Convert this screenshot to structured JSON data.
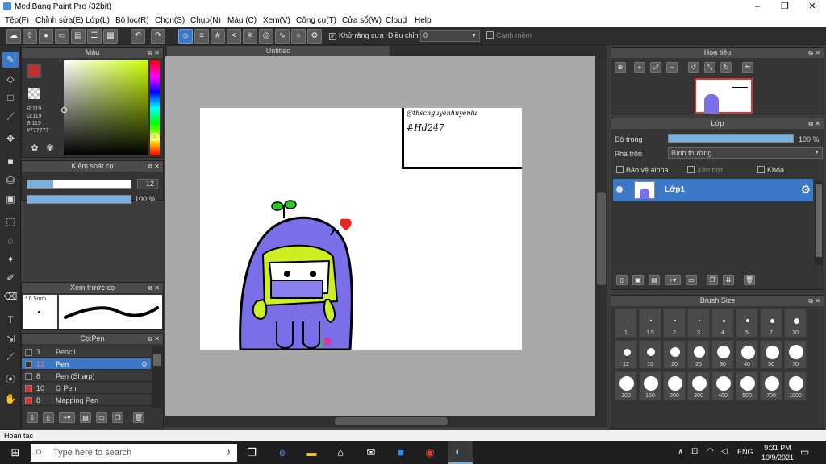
{
  "window": {
    "title": "MediBang Paint Pro (32bit)",
    "min": "–",
    "max": "❐",
    "close": "✕"
  },
  "menu": [
    "Tệp(F)",
    "Chỉnh sửa(E)",
    "Lớp(L)",
    "Bộ lọc(R)",
    "Chọn(S)",
    "Chụp(N)",
    "Màu (C)",
    "Xem(V)",
    "Công cụ(T)",
    "Cửa sổ(W)",
    "Cloud",
    "Help"
  ],
  "toolbar": {
    "antialias": "Khử răng cưa",
    "adjust_label": "Điều chỉnh",
    "adjust_value": "0",
    "edge": "Cạnh mềm"
  },
  "color_panel": {
    "title": "Màu",
    "r": "R:119",
    "g": "G:119",
    "b": "B:119",
    "hex": "#777777",
    "colors": {
      "primary": "#c03030",
      "accent": "#3c78c8"
    }
  },
  "brush_control": {
    "title": "Kiểm soát cọ",
    "size": "12",
    "opacity": "100 %",
    "size_fraction": 0.25,
    "opacity_fraction": 1.0
  },
  "brush_preview": {
    "title": "Xem trước cọ",
    "size": "0.5mm"
  },
  "brush_list": {
    "title": "Cọ:Pen",
    "items": [
      {
        "size": "3",
        "name": "Pencil",
        "color": "#333333"
      },
      {
        "size": "12",
        "name": "Pen",
        "color": "#333333",
        "selected": true
      },
      {
        "size": "8",
        "name": "Pen (Sharp)",
        "color": "#333333"
      },
      {
        "size": "10",
        "name": "G Pen",
        "color": "#e03030"
      },
      {
        "size": "8",
        "name": "Mapping Pen",
        "color": "#e03030"
      }
    ]
  },
  "canvas": {
    "tab": "Untitled",
    "sig_line1": "@thscnguyenhuyenlu",
    "sig_line2": "#Hd247"
  },
  "navigator": {
    "title": "Hoa tiêu"
  },
  "layer_panel": {
    "title": "Lớp",
    "opacity_label": "Độ trong",
    "opacity_value": "100 %",
    "blend_label": "Pha trộn",
    "blend_value": "Bình thường",
    "protect_alpha": "Bảo vệ alpha",
    "clip": "Xén bớt",
    "lock": "Khóa",
    "layer_name": "Lớp1"
  },
  "brush_size": {
    "title": "Brush Size",
    "sizes": [
      "1",
      "1.5",
      "2",
      "3",
      "4",
      "5",
      "7",
      "10",
      "12",
      "15",
      "20",
      "25",
      "30",
      "40",
      "50",
      "70",
      "100",
      "150",
      "200",
      "300",
      "400",
      "500",
      "700",
      "1000"
    ]
  },
  "status": "Hoàn tác",
  "taskbar": {
    "search": "Type here to search",
    "lang": "ENG",
    "time": "9:31 PM",
    "date": "10/9/2021"
  }
}
